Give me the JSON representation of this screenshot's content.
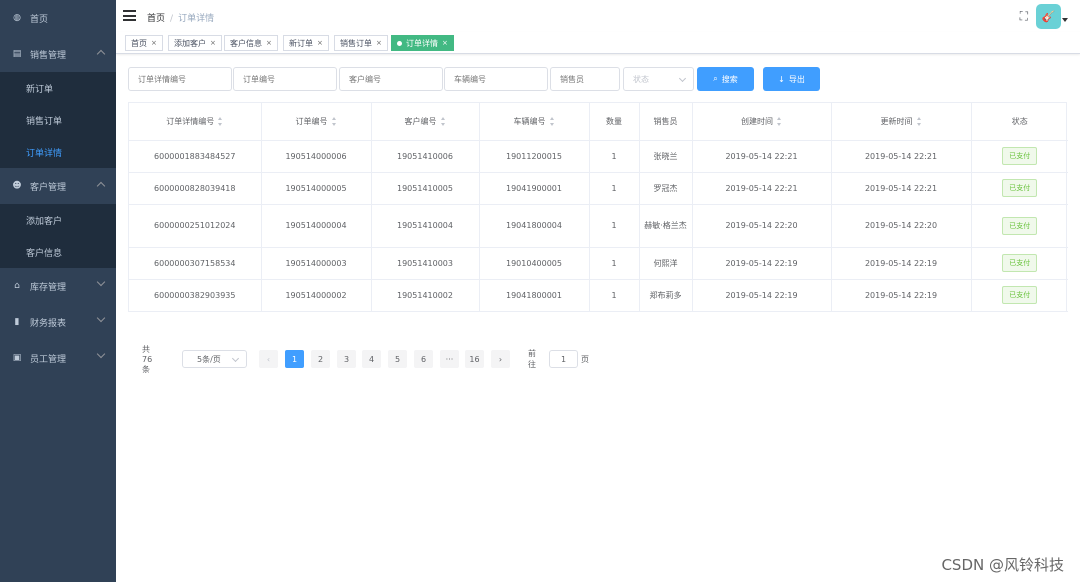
{
  "sidebar": {
    "items": [
      {
        "label": "首页",
        "icon": "dashboard-icon"
      },
      {
        "label": "销售管理",
        "icon": "document-icon",
        "sub": [
          "新订单",
          "销售订单",
          "订单详情"
        ]
      },
      {
        "label": "客户管理",
        "icon": "users-icon",
        "sub": [
          "添加客户",
          "客户信息"
        ]
      },
      {
        "label": "库存管理",
        "icon": "warehouse-icon"
      },
      {
        "label": "财务报表",
        "icon": "bar-chart-icon"
      },
      {
        "label": "员工管理",
        "icon": "id-card-icon"
      }
    ]
  },
  "header": {
    "breadcrumb_home": "首页",
    "breadcrumb_current": "订单详情"
  },
  "tags": [
    {
      "label": "首页"
    },
    {
      "label": "添加客户"
    },
    {
      "label": "客户信息"
    },
    {
      "label": "新订单"
    },
    {
      "label": "销售订单"
    },
    {
      "label": "订单详情",
      "active": true
    }
  ],
  "filters": {
    "detail_no": "订单详情编号",
    "order_no": "订单编号",
    "customer_no": "客户编号",
    "vehicle_no": "车辆编号",
    "salesperson": "销售员",
    "status": "状态",
    "search_label": "搜索",
    "export_label": "导出"
  },
  "table": {
    "columns": [
      "订单详情编号",
      "订单编号",
      "客户编号",
      "车辆编号",
      "数量",
      "销售员",
      "创建时间",
      "更新时间",
      "状态"
    ],
    "rows": [
      [
        "6000001883484527",
        "190514000006",
        "19051410006",
        "19011200015",
        "1",
        "张晓兰",
        "2019-05-14 22:21",
        "2019-05-14 22:21",
        "已支付"
      ],
      [
        "6000000828039418",
        "190514000005",
        "19051410005",
        "19041900001",
        "1",
        "罗冠杰",
        "2019-05-14 22:21",
        "2019-05-14 22:21",
        "已支付"
      ],
      [
        "6000000251012024",
        "190514000004",
        "19051410004",
        "19041800004",
        "1",
        "赫敏·格兰杰",
        "2019-05-14 22:20",
        "2019-05-14 22:20",
        "已支付"
      ],
      [
        "6000000307158534",
        "190514000003",
        "19051410003",
        "19010400005",
        "1",
        "何熙洋",
        "2019-05-14 22:19",
        "2019-05-14 22:19",
        "已支付"
      ],
      [
        "6000000382903935",
        "190514000002",
        "19051410002",
        "19041800001",
        "1",
        "郑布莉多",
        "2019-05-14 22:19",
        "2019-05-14 22:19",
        "已支付"
      ]
    ]
  },
  "pagination": {
    "total": "共 76 条",
    "page_size": "5条/页",
    "pages": [
      "1",
      "2",
      "3",
      "4",
      "5",
      "6",
      "···",
      "16"
    ],
    "goto_label": "前往",
    "goto_value": "1",
    "page_suffix": "页"
  },
  "watermark": "CSDN @风铃科技",
  "colors": {
    "sidebar": "#304156",
    "primary": "#409eff",
    "active_tag": "#42b983",
    "paid": "#67c23a"
  }
}
